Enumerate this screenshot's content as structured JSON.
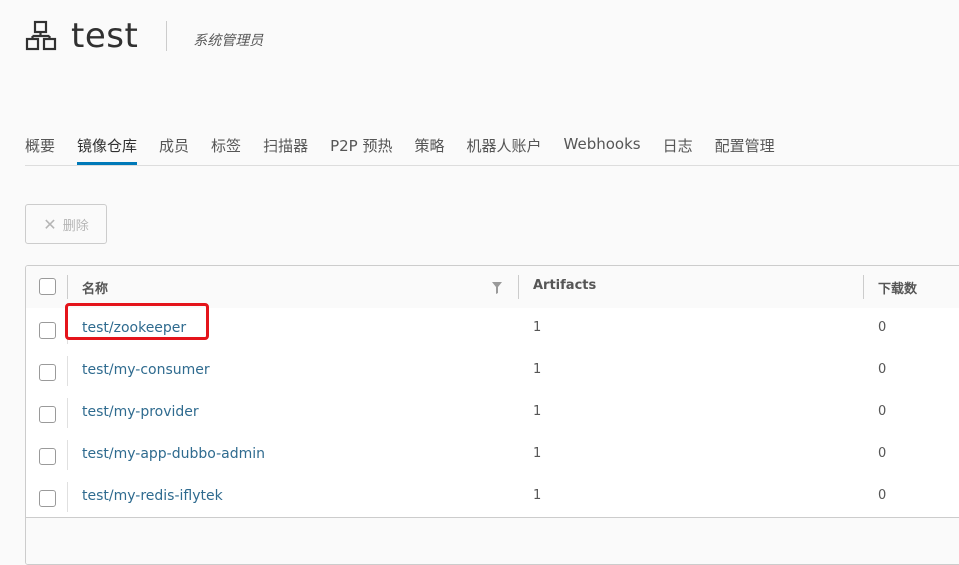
{
  "header": {
    "project_name": "test",
    "role": "系统管理员",
    "icon": "project-network-icon"
  },
  "tabs": [
    {
      "label": "概要",
      "active": false
    },
    {
      "label": "镜像仓库",
      "active": true
    },
    {
      "label": "成员",
      "active": false
    },
    {
      "label": "标签",
      "active": false
    },
    {
      "label": "扫描器",
      "active": false
    },
    {
      "label": "P2P 预热",
      "active": false
    },
    {
      "label": "策略",
      "active": false
    },
    {
      "label": "机器人账户",
      "active": false
    },
    {
      "label": "Webhooks",
      "active": false
    },
    {
      "label": "日志",
      "active": false
    },
    {
      "label": "配置管理",
      "active": false
    }
  ],
  "toolbar": {
    "delete_label": "删除",
    "delete_icon": "close-icon"
  },
  "table": {
    "columns": [
      "名称",
      "Artifacts",
      "下载数"
    ],
    "rows": [
      {
        "name": "test/zookeeper",
        "artifacts": "1",
        "downloads": "0"
      },
      {
        "name": "test/my-consumer",
        "artifacts": "1",
        "downloads": "0"
      },
      {
        "name": "test/my-provider",
        "artifacts": "1",
        "downloads": "0"
      },
      {
        "name": "test/my-app-dubbo-admin",
        "artifacts": "1",
        "downloads": "0"
      },
      {
        "name": "test/my-redis-iflytek",
        "artifacts": "1",
        "downloads": "0"
      }
    ]
  },
  "colors": {
    "accent": "#0079b8",
    "link": "#2f6b8f",
    "highlight": "#e4141b"
  }
}
